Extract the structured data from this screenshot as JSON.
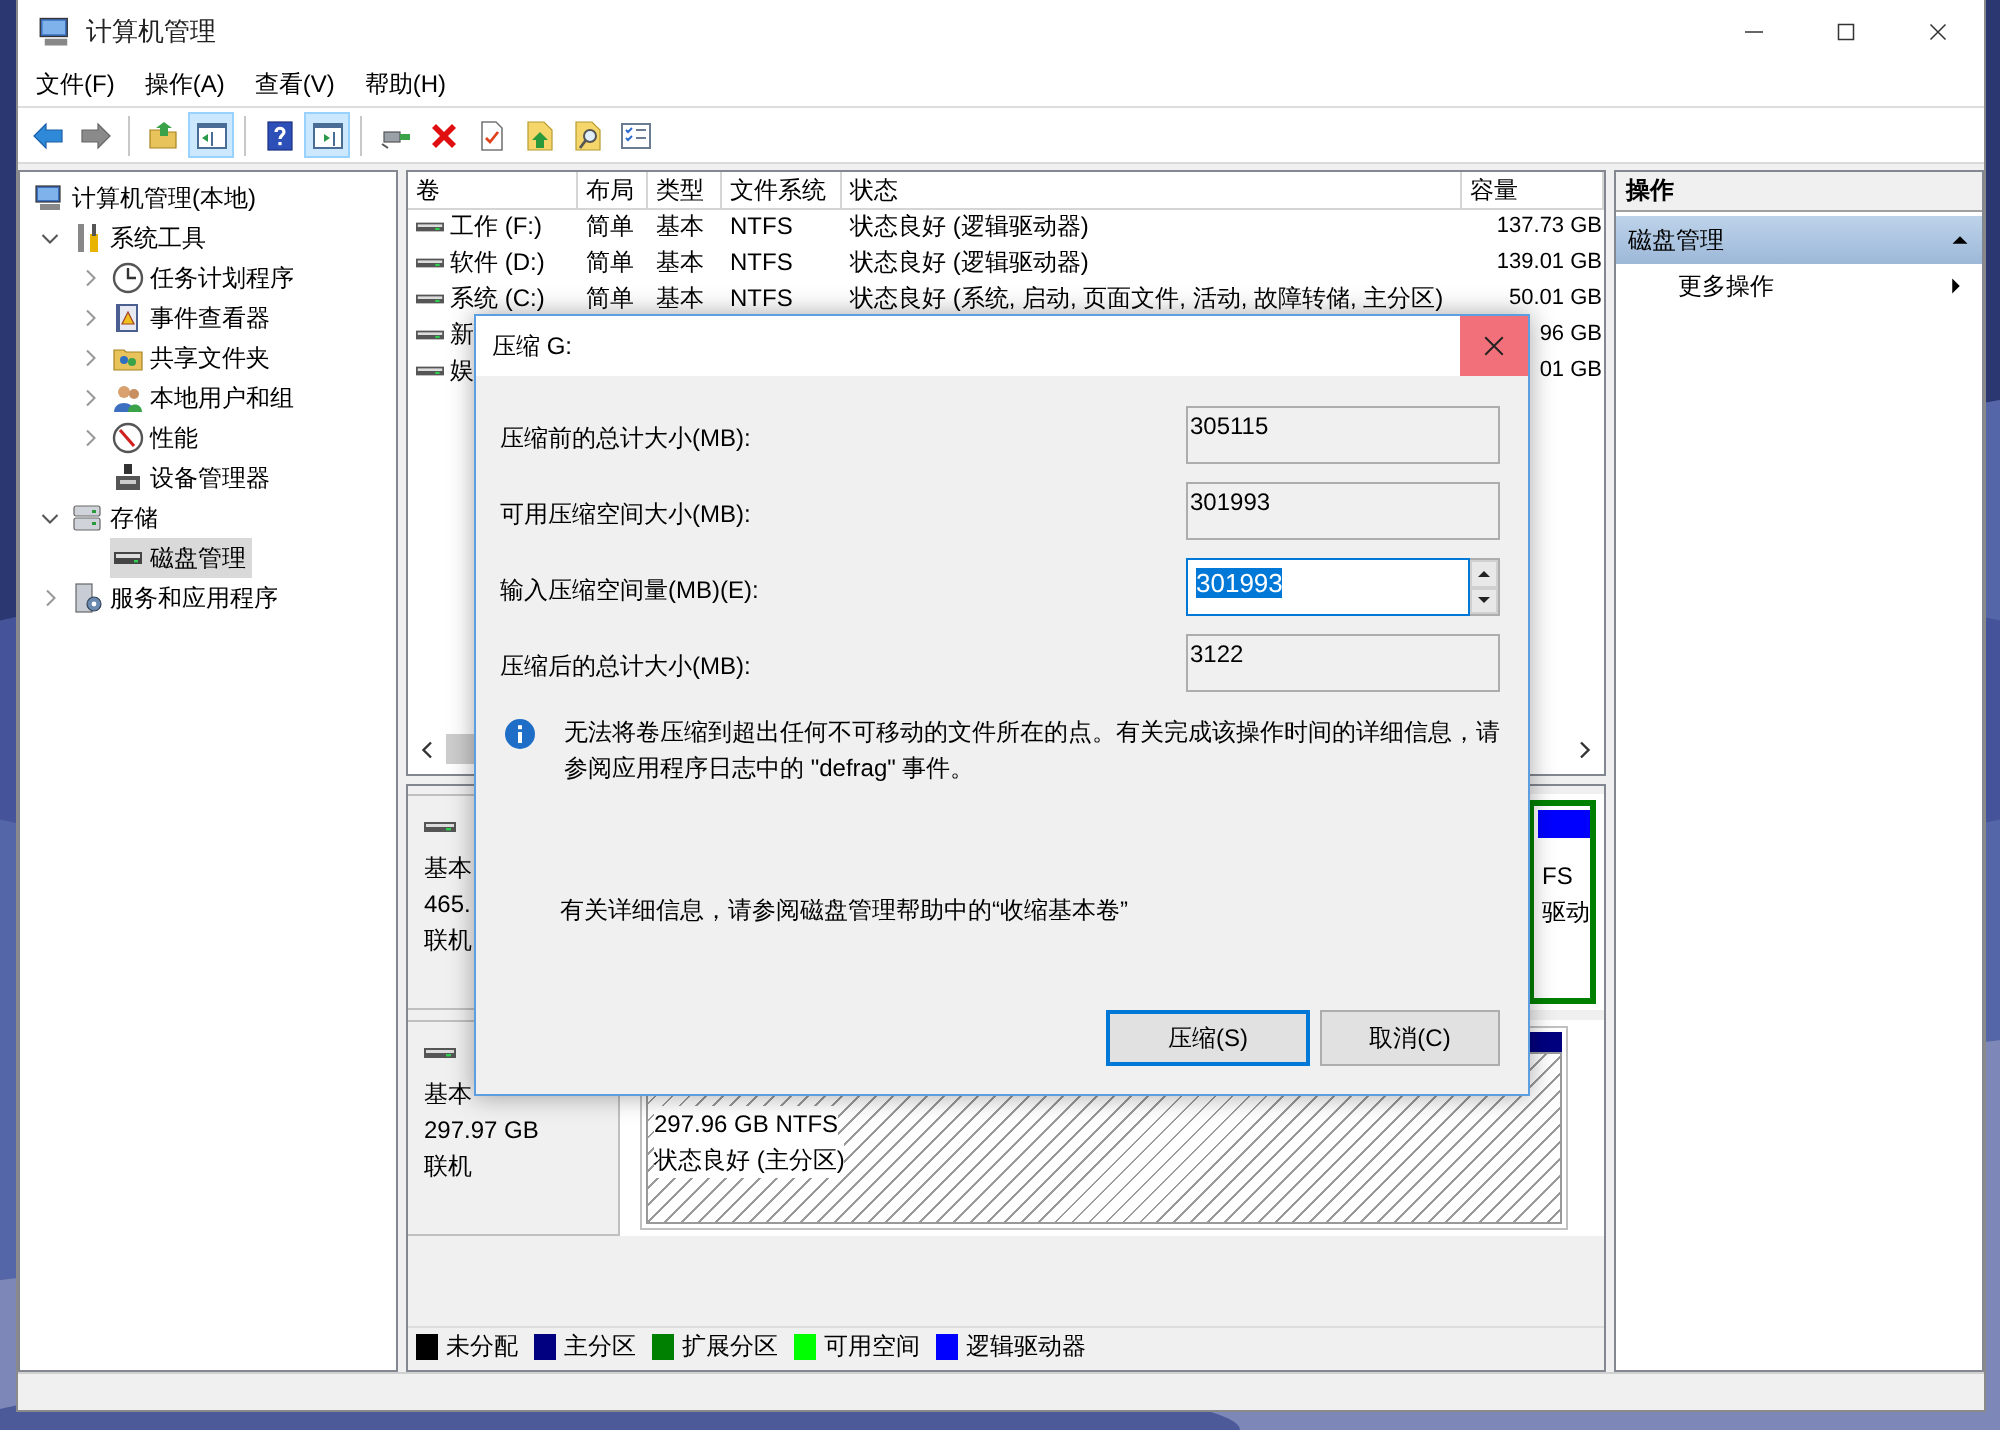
{
  "window": {
    "title": "计算机管理"
  },
  "menu": [
    "文件(F)",
    "操作(A)",
    "查看(V)",
    "帮助(H)"
  ],
  "toolbar": [
    {
      "kind": "back",
      "pressed": false
    },
    {
      "kind": "forward",
      "pressed": false
    },
    {
      "kind": "separator"
    },
    {
      "kind": "up",
      "pressed": false
    },
    {
      "kind": "tree",
      "pressed": true
    },
    {
      "kind": "separator"
    },
    {
      "kind": "help",
      "pressed": false
    },
    {
      "kind": "actionpane",
      "pressed": true
    },
    {
      "kind": "separator"
    },
    {
      "kind": "connect",
      "pressed": false
    },
    {
      "kind": "delete",
      "pressed": false
    },
    {
      "kind": "properties",
      "pressed": false
    },
    {
      "kind": "folderup",
      "pressed": false
    },
    {
      "kind": "foldersearch",
      "pressed": false
    },
    {
      "kind": "checklist",
      "pressed": false
    }
  ],
  "tree": [
    {
      "label": "计算机管理(本地)",
      "kind": "computer",
      "selected": false,
      "children": [
        {
          "label": "系统工具",
          "kind": "tools",
          "expanded": true,
          "selected": false,
          "children": [
            {
              "label": "任务计划程序",
              "kind": "clock",
              "expanded": false,
              "selected": false
            },
            {
              "label": "事件查看器",
              "kind": "event",
              "expanded": false,
              "selected": false
            },
            {
              "label": "共享文件夹",
              "kind": "share",
              "expanded": false,
              "selected": false
            },
            {
              "label": "本地用户和组",
              "kind": "users",
              "expanded": false,
              "selected": false
            },
            {
              "label": "性能",
              "kind": "perf",
              "expanded": false,
              "selected": false
            },
            {
              "label": "设备管理器",
              "kind": "device",
              "selected": false
            }
          ]
        },
        {
          "label": "存储",
          "kind": "storage",
          "expanded": true,
          "selected": false,
          "children": [
            {
              "label": "磁盘管理",
              "kind": "disk",
              "selected": true
            }
          ]
        },
        {
          "label": "服务和应用程序",
          "kind": "services",
          "expanded": false,
          "selected": false
        }
      ]
    }
  ],
  "volumes": {
    "columns": [
      "卷",
      "布局",
      "类型",
      "文件系统",
      "状态",
      "容量"
    ],
    "rows": [
      {
        "volume": "工作 (F:)",
        "layout": "简单",
        "type": "基本",
        "file_system": "NTFS",
        "status": "状态良好 (逻辑驱动器)",
        "capacity": "137.73 GB"
      },
      {
        "volume": "软件 (D:)",
        "layout": "简单",
        "type": "基本",
        "file_system": "NTFS",
        "status": "状态良好 (逻辑驱动器)",
        "capacity": "139.01 GB"
      },
      {
        "volume": "系统 (C:)",
        "layout": "简单",
        "type": "基本",
        "file_system": "NTFS",
        "status": "状态良好 (系统, 启动, 页面文件, 活动, 故障转储, 主分区)",
        "capacity": "50.01 GB"
      },
      {
        "volume": "新",
        "capacity": "96 GB"
      },
      {
        "volume": "娱",
        "capacity": "01 GB"
      }
    ]
  },
  "disks": [
    {
      "lines": [
        "基本",
        "465.",
        "联机"
      ],
      "partition": {
        "kind": "logical",
        "lines": [
          "FS",
          "驱动"
        ]
      }
    },
    {
      "lines": [
        "基本",
        "297.97 GB",
        "联机"
      ],
      "partition": {
        "kind": "primary",
        "lines": [
          "297.96 GB NTFS",
          "状态良好 (主分区)"
        ]
      }
    }
  ],
  "legend": [
    {
      "label": "未分配",
      "color": "#000000"
    },
    {
      "label": "主分区",
      "color": "#000080"
    },
    {
      "label": "扩展分区",
      "color": "#008000"
    },
    {
      "label": "可用空间",
      "color": "#00ff00"
    },
    {
      "label": "逻辑驱动器",
      "color": "#0000ff"
    }
  ],
  "actions": {
    "header": "操作",
    "items": [
      {
        "label": "磁盘管理",
        "kind": "section"
      },
      {
        "label": "更多操作",
        "kind": "submenu"
      }
    ]
  },
  "dialog": {
    "title": "压缩 G:",
    "fields": [
      {
        "label": "压缩前的总计大小(MB):",
        "value": "305115",
        "kind": "readonly"
      },
      {
        "label": "可用压缩空间大小(MB):",
        "value": "301993",
        "kind": "readonly"
      },
      {
        "label": "输入压缩空间量(MB)(E):",
        "value": "301993",
        "kind": "spinner",
        "text_selected": true
      },
      {
        "label": "压缩后的总计大小(MB):",
        "value": "3122",
        "kind": "readonly"
      }
    ],
    "info": "无法将卷压缩到超出任何不可移动的文件所在的点。有关完成该操作时间的详细信息，请参阅应用程序日志中的 \"defrag\" 事件。",
    "help": "有关详细信息，请参阅磁盘管理帮助中的“收缩基本卷”",
    "buttons": [
      {
        "label": "压缩(S)",
        "default": true
      },
      {
        "label": "取消(C)",
        "default": false
      }
    ]
  }
}
